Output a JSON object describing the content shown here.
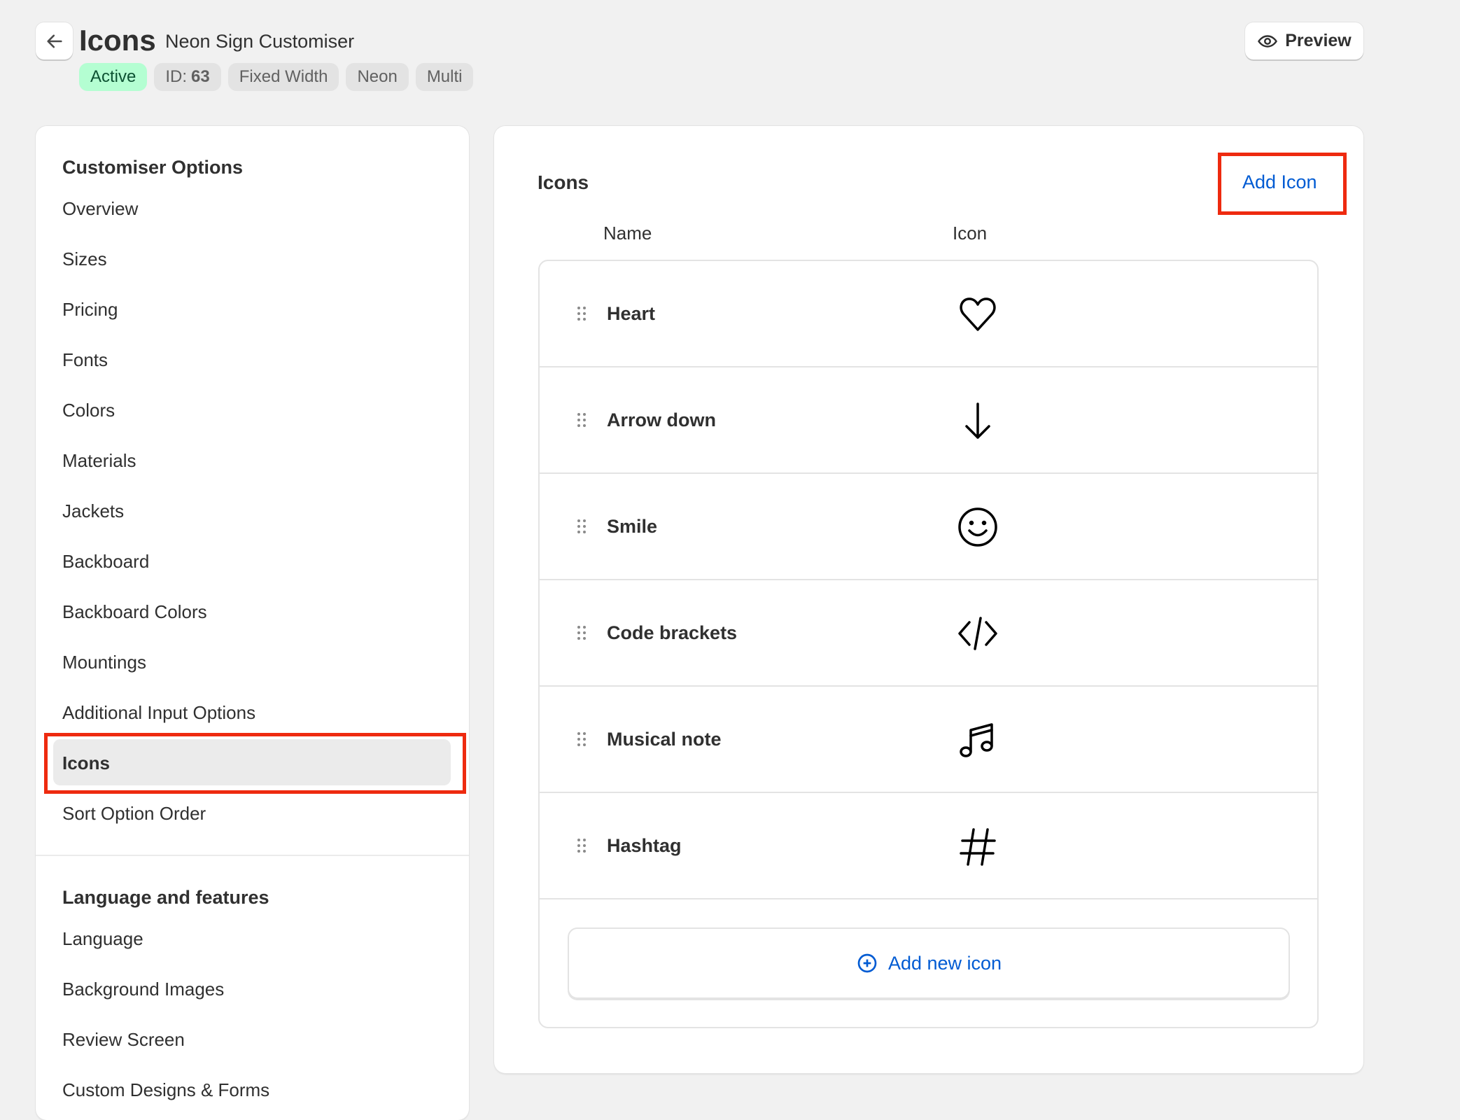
{
  "header": {
    "title": "Icons",
    "subtitle": "Neon Sign Customiser",
    "badges": {
      "status": "Active",
      "id_label": "ID:",
      "id_value": "63",
      "b1": "Fixed Width",
      "b2": "Neon",
      "b3": "Multi"
    },
    "preview": "Preview"
  },
  "sidebar": {
    "section1": "Customiser Options",
    "items": [
      "Overview",
      "Sizes",
      "Pricing",
      "Fonts",
      "Colors",
      "Materials",
      "Jackets",
      "Backboard",
      "Backboard Colors",
      "Mountings",
      "Additional Input Options",
      "Icons",
      "Sort Option Order"
    ],
    "section2": "Language and features",
    "items2": [
      "Language",
      "Background Images",
      "Review Screen",
      "Custom Designs & Forms"
    ]
  },
  "main": {
    "heading": "Icons",
    "add_icon": "Add Icon",
    "col_name": "Name",
    "col_icon": "Icon",
    "rows": [
      {
        "name": "Heart",
        "icon": "heart-icon"
      },
      {
        "name": "Arrow down",
        "icon": "arrow-down-icon"
      },
      {
        "name": "Smile",
        "icon": "smile-icon"
      },
      {
        "name": "Code brackets",
        "icon": "code-brackets-icon"
      },
      {
        "name": "Musical note",
        "icon": "musical-note-icon"
      },
      {
        "name": "Hashtag",
        "icon": "hashtag-icon"
      }
    ],
    "add_new": "Add new icon"
  },
  "colors": {
    "accent": "#005bd3",
    "highlight": "#ee2a0f",
    "active_badge": "#b4fed2"
  }
}
